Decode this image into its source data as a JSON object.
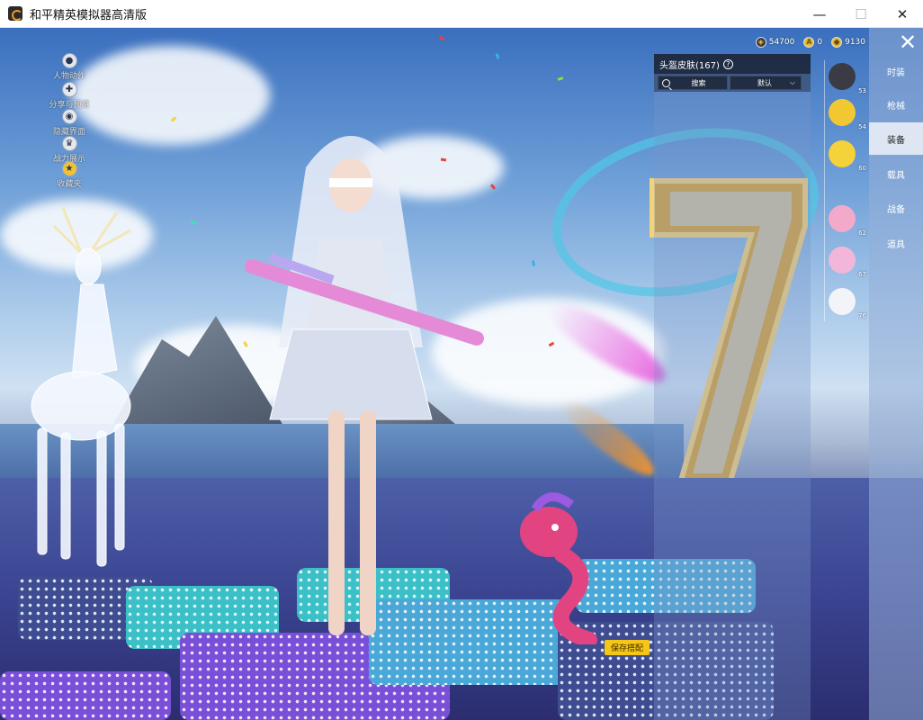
{
  "window": {
    "title": "和平精英模拟器高清版",
    "controls": {
      "minimize": "—",
      "maximize": "☐",
      "close": "✕"
    }
  },
  "currency": [
    {
      "icon": "coin-icon",
      "value": "54700"
    },
    {
      "icon": "token-icon",
      "value": "0"
    },
    {
      "icon": "gold-icon",
      "value": "9130"
    }
  ],
  "left_menu": [
    {
      "label": "人物动作",
      "icon": "person-icon"
    },
    {
      "label": "分享与预览",
      "icon": "share-icon"
    },
    {
      "label": "隐藏界面",
      "icon": "eye-icon"
    },
    {
      "label": "战力展示",
      "icon": "crown-icon"
    },
    {
      "label": "收藏夹",
      "icon": "star-badge-icon"
    }
  ],
  "panel": {
    "title": "头盔皮肤(167)",
    "help": "?",
    "search_placeholder": "搜索",
    "sort_label": "默认"
  },
  "categories": [
    {
      "label": "时装",
      "active": false
    },
    {
      "label": "枪械",
      "active": false
    },
    {
      "label": "装备",
      "active": true
    },
    {
      "label": "载具",
      "active": false
    },
    {
      "label": "战备",
      "active": false
    },
    {
      "label": "道具",
      "active": false
    }
  ],
  "skins": [
    {
      "level": "53",
      "color": "#3b3b46"
    },
    {
      "level": "54",
      "color": "#f2c832"
    },
    {
      "level": "60",
      "color": "#f5d23a"
    },
    {
      "level": "62",
      "color": "#f3a9c9"
    },
    {
      "level": "67",
      "color": "#f1b6d8"
    },
    {
      "level": "76",
      "color": "#f2f4f7"
    }
  ],
  "save_button": "保存搭配",
  "close_symbol": "✕",
  "colors": {
    "accent": "#f5c518",
    "panel_header": "#141a28",
    "active_tab": "#e6ecf6"
  }
}
